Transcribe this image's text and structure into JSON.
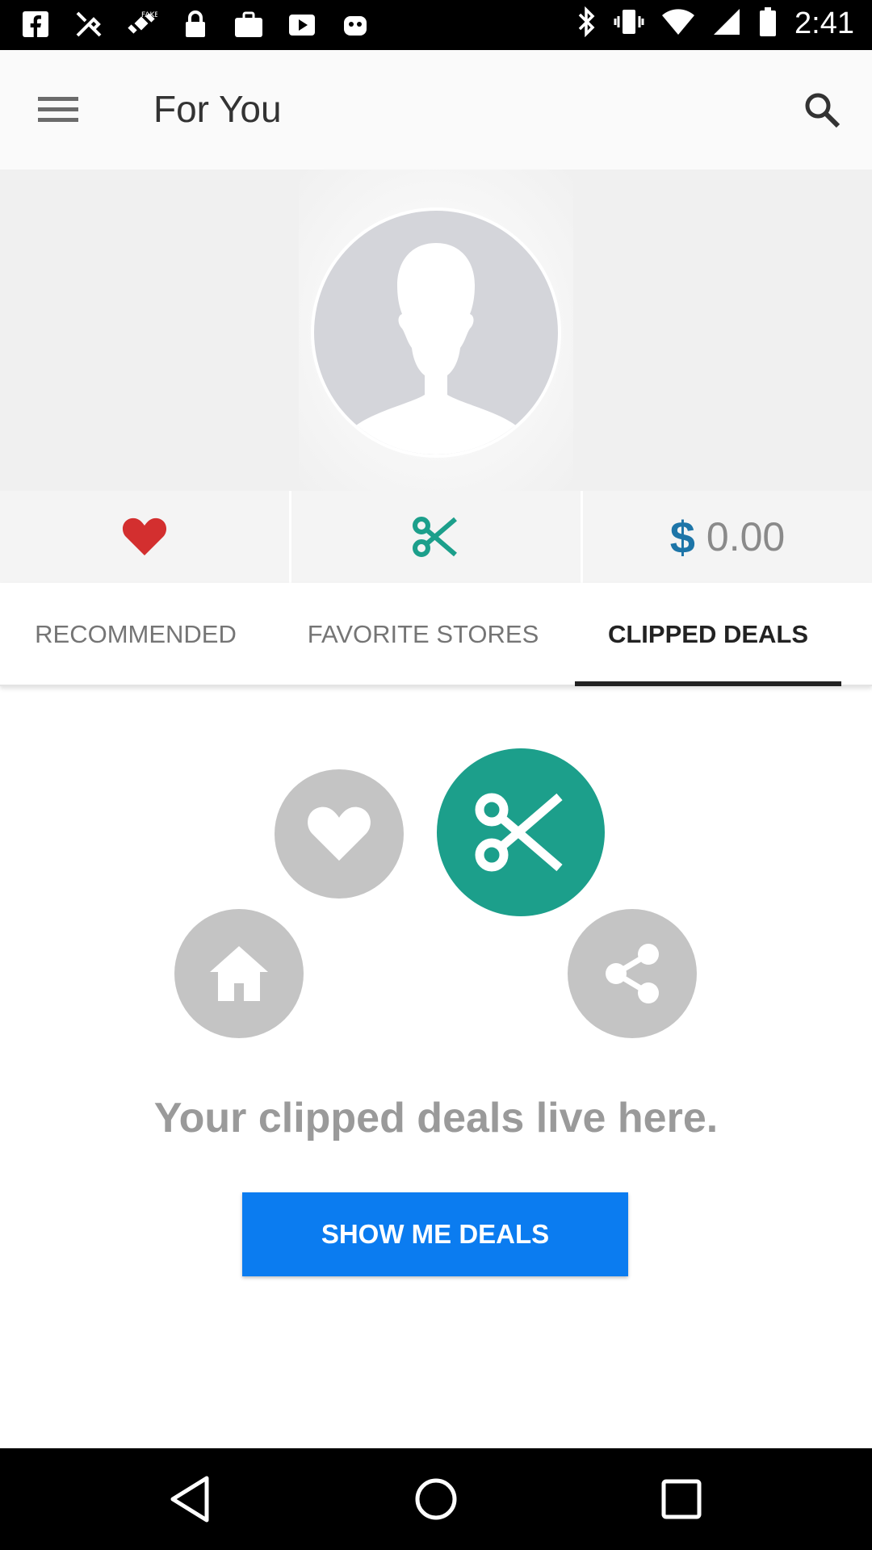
{
  "status_bar": {
    "time": "2:41",
    "left_icons": [
      "facebook-icon",
      "tools-icon",
      "satellite-icon",
      "lock-icon",
      "briefcase-icon",
      "play-store-icon",
      "robot-icon"
    ],
    "right_icons": [
      "bluetooth-icon",
      "vibrate-icon",
      "wifi-icon",
      "signal-icon",
      "battery-icon"
    ]
  },
  "app_bar": {
    "title": "For You",
    "menu_icon": "hamburger-menu-icon",
    "search_icon": "search-icon"
  },
  "profile": {
    "avatar_icon": "default-avatar-silhouette"
  },
  "stats": {
    "favorites_icon": "heart-icon",
    "clipped_icon": "scissors-icon",
    "currency_symbol": "$",
    "savings_amount": "0.00"
  },
  "tabs": [
    {
      "label": "RECOMMENDED",
      "active": false
    },
    {
      "label": "FAVORITE STORES",
      "active": false
    },
    {
      "label": "CLIPPED DEALS",
      "active": true
    }
  ],
  "empty_state": {
    "icons": [
      "heart-icon",
      "scissors-icon",
      "home-icon",
      "share-icon"
    ],
    "message": "Your clipped deals live here.",
    "button_label": "SHOW ME DEALS"
  },
  "nav_bar": {
    "icons": [
      "back-icon",
      "home-icon",
      "recents-icon"
    ]
  },
  "colors": {
    "accent_teal": "#1c9f8b",
    "heart_red": "#d32f2f",
    "dollar_blue": "#1d75a8",
    "button_blue": "#0b7cf0",
    "muted_grey": "#c4c4c4"
  }
}
